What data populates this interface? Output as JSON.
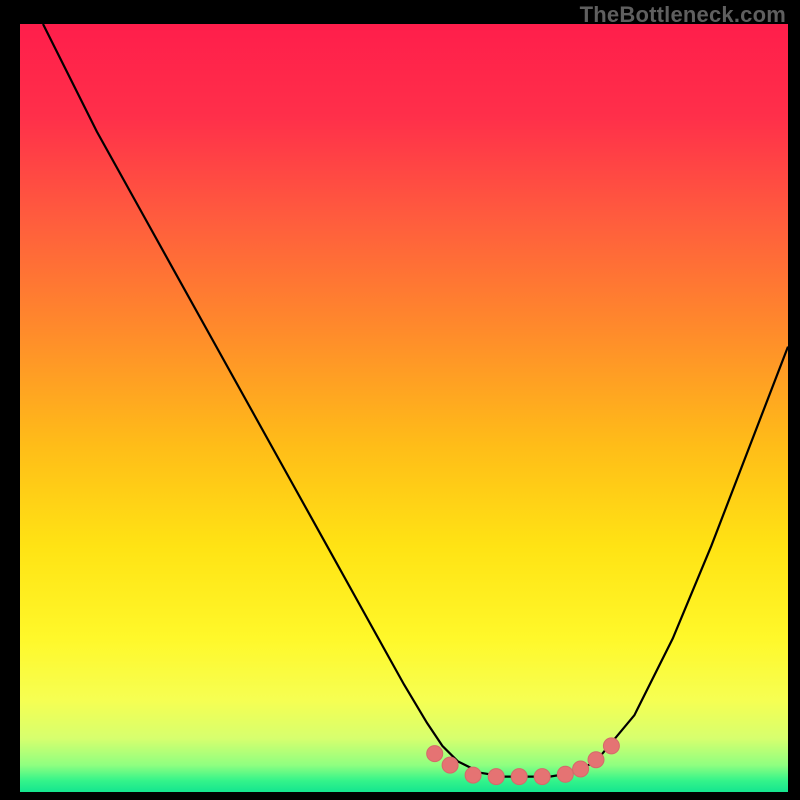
{
  "watermark": "TheBottleneck.com",
  "colors": {
    "background": "#000000",
    "curve": "#000000",
    "gradient_stops": [
      {
        "offset": 0.0,
        "color": "#ff1e4b"
      },
      {
        "offset": 0.12,
        "color": "#ff2f4a"
      },
      {
        "offset": 0.25,
        "color": "#ff5b3e"
      },
      {
        "offset": 0.4,
        "color": "#ff8b2b"
      },
      {
        "offset": 0.55,
        "color": "#ffbd18"
      },
      {
        "offset": 0.68,
        "color": "#ffe314"
      },
      {
        "offset": 0.8,
        "color": "#fff82a"
      },
      {
        "offset": 0.88,
        "color": "#f6ff52"
      },
      {
        "offset": 0.93,
        "color": "#d7ff6e"
      },
      {
        "offset": 0.965,
        "color": "#8fff80"
      },
      {
        "offset": 0.985,
        "color": "#35f48a"
      },
      {
        "offset": 1.0,
        "color": "#14e58f"
      }
    ],
    "marker_fill": "#e57373",
    "marker_stroke": "#d46a6a"
  },
  "chart_data": {
    "type": "line",
    "title": "",
    "xlabel": "",
    "ylabel": "",
    "xlim": [
      0,
      100
    ],
    "ylim": [
      0,
      100
    ],
    "series": [
      {
        "name": "bottleneck-curve",
        "x": [
          3,
          6,
          10,
          15,
          20,
          25,
          30,
          35,
          40,
          45,
          50,
          53,
          55,
          57,
          60,
          63,
          66,
          69,
          72,
          75,
          80,
          85,
          90,
          95,
          100
        ],
        "y": [
          100,
          94,
          86,
          77,
          68,
          59,
          50,
          41,
          32,
          23,
          14,
          9,
          6,
          4,
          2.5,
          2,
          2,
          2,
          2.5,
          4,
          10,
          20,
          32,
          45,
          58
        ]
      }
    ],
    "markers": {
      "name": "bottom-cluster",
      "points": [
        {
          "x": 54,
          "y": 5.0
        },
        {
          "x": 56,
          "y": 3.5
        },
        {
          "x": 59,
          "y": 2.2
        },
        {
          "x": 62,
          "y": 2.0
        },
        {
          "x": 65,
          "y": 2.0
        },
        {
          "x": 68,
          "y": 2.0
        },
        {
          "x": 71,
          "y": 2.3
        },
        {
          "x": 73,
          "y": 3.0
        },
        {
          "x": 75,
          "y": 4.2
        },
        {
          "x": 77,
          "y": 6.0
        }
      ],
      "radius": 8
    }
  }
}
